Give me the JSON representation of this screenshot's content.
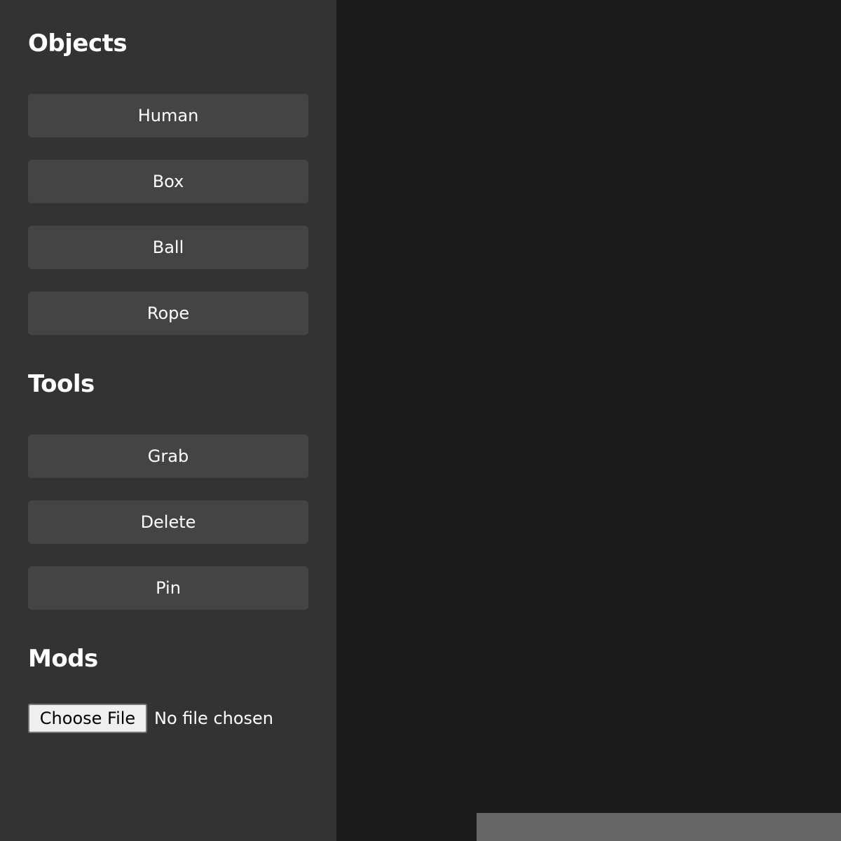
{
  "sidebar": {
    "objects": {
      "title": "Objects",
      "buttons": [
        "Human",
        "Box",
        "Ball",
        "Rope"
      ]
    },
    "tools": {
      "title": "Tools",
      "buttons": [
        "Grab",
        "Delete",
        "Pin"
      ]
    },
    "mods": {
      "title": "Mods",
      "file_button": "Choose File",
      "file_status": "No file chosen"
    }
  },
  "colors": {
    "sidebar_bg": "#333333",
    "button_bg": "#444444",
    "canvas_bg": "#1b1b1b",
    "ground": "#666666"
  }
}
